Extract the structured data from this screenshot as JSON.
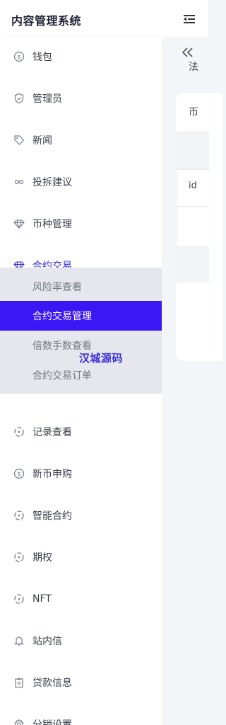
{
  "header": {
    "app_title": "内容管理系统"
  },
  "sidebar": {
    "items": [
      {
        "label": "钱包",
        "icon": "dollar-circle-icon"
      },
      {
        "label": "管理员",
        "icon": "shield-check-icon"
      },
      {
        "label": "新闻",
        "icon": "tag-icon"
      },
      {
        "label": "投拆建议",
        "icon": "infinity-icon"
      },
      {
        "label": "币种管理",
        "icon": "diamond-icon"
      },
      {
        "label": "合约交易",
        "icon": "diamond-icon",
        "active": true
      },
      {
        "label": "记录查看",
        "icon": "dashed-circle-icon"
      },
      {
        "label": "新币申购",
        "icon": "dollar-circle-icon"
      },
      {
        "label": "智能合约",
        "icon": "dashed-circle-icon"
      },
      {
        "label": "期权",
        "icon": "dashed-circle-icon"
      },
      {
        "label": "NFT",
        "icon": "dashed-circle-icon"
      },
      {
        "label": "站内信",
        "icon": "bell-icon"
      },
      {
        "label": "贷款信息",
        "icon": "clipboard-icon"
      },
      {
        "label": "分销设置",
        "icon": "gear-icon"
      }
    ],
    "submenu": [
      {
        "label": "风险率查看"
      },
      {
        "label": "合约交易管理",
        "selected": true
      },
      {
        "label": "倍数手数查看"
      },
      {
        "label": "合约交易订单"
      }
    ]
  },
  "watermark": "汉城源码",
  "main": {
    "card_line1": "法",
    "card_line2": "币",
    "table_cell": "id"
  },
  "colors": {
    "accent": "#3a2fd6",
    "selected_bg": "#3c17f5",
    "submenu_bg": "#e6e7ec",
    "page_bg": "#f4f5f9"
  }
}
